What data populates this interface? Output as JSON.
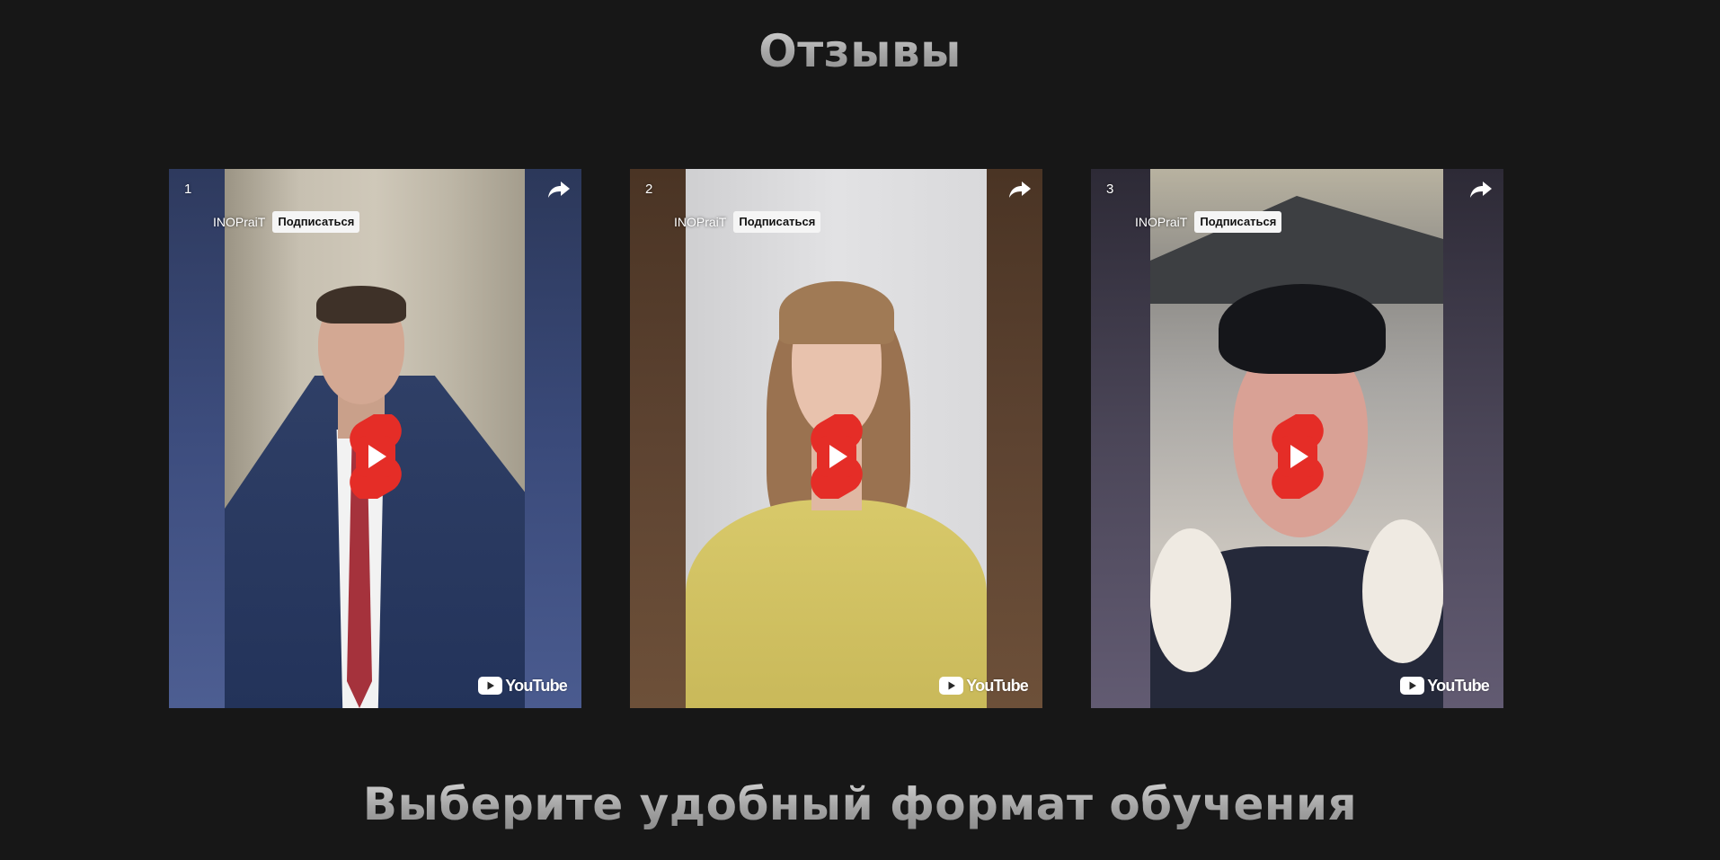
{
  "headings": {
    "reviews": "Отзывы",
    "choose_format": "Выберите удобный формат обучения"
  },
  "videos": [
    {
      "index": "1",
      "channel": "INOPraiT",
      "subscribe_label": "Подписаться",
      "platform": "YouTube"
    },
    {
      "index": "2",
      "channel": "INOPraiT",
      "subscribe_label": "Подписаться",
      "platform": "YouTube"
    },
    {
      "index": "3",
      "channel": "INOPraiT",
      "subscribe_label": "Подписаться",
      "platform": "YouTube"
    }
  ],
  "icons": {
    "share": "share-icon",
    "play": "youtube-shorts-play-icon",
    "youtube": "youtube-logo-icon"
  },
  "colors": {
    "page_background": "#171717",
    "shorts_red": "#e52d27",
    "heading_gray": "#a8a8a8"
  }
}
